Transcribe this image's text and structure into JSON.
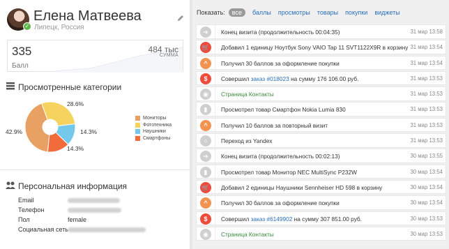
{
  "profile": {
    "name": "Елена Матвеева",
    "city": "Липецк, Россия"
  },
  "stats": {
    "main_value": "335",
    "main_label": "Балл",
    "sum_value": "484 тыс",
    "sum_label": "СУММА"
  },
  "categories": {
    "title": "Просмотренные категории",
    "legend": [
      "Мониторы",
      "Фототехника",
      "Наушники",
      "Смартфоны"
    ]
  },
  "chart_data": {
    "type": "pie",
    "labels": [
      "Мониторы",
      "Фототехника",
      "Наушники",
      "Смартфоны"
    ],
    "values": [
      42.9,
      28.6,
      14.3,
      14.3
    ],
    "value_labels": [
      "42.9%",
      "28.6%",
      "14.3%",
      "14.3%"
    ],
    "colors": [
      "#e8a163",
      "#f5d35e",
      "#73c8ec",
      "#f26b3b"
    ],
    "legend_position": "right"
  },
  "personal": {
    "title": "Персональная информация",
    "rows": [
      {
        "label": "Email",
        "value": ""
      },
      {
        "label": "Телефон",
        "value": ""
      },
      {
        "label": "Пол",
        "value": "female"
      },
      {
        "label": "Социальная сеть",
        "value": ""
      }
    ]
  },
  "filter": {
    "label": "Показать:",
    "tabs": [
      "все",
      "баллы",
      "просмотры",
      "товары",
      "покупки",
      "виджеты"
    ]
  },
  "feed": [
    {
      "icon": "exit-icon",
      "color": "#cfcfcf",
      "glyph": "➔",
      "text": "Конец визита (продолжительность 00:04:35)",
      "date": "31 мар 13:58"
    },
    {
      "icon": "cart-icon",
      "color": "#ef4b3c",
      "glyph": "🛒",
      "text": "Добавил 1 единицу Ноутбук Sony VAIO Tap 11 SVT1122X9R в корзину",
      "date": "31 мар 13:54"
    },
    {
      "icon": "points-up-icon",
      "color": "#f4934f",
      "glyph": "^",
      "text": "Получил 30 баллов за оформление покупки",
      "date": "31 мар 13:54"
    },
    {
      "icon": "dollar-icon",
      "color": "#ef4b3c",
      "glyph": "$",
      "pre": "Совершил ",
      "link": "заказ #018023",
      "post": " на сумму 176 106.00 руб.",
      "date": "31 мар 13:53"
    },
    {
      "icon": "eye-icon",
      "color": "#cfcfcf",
      "glyph": "◉",
      "text": "Страница Контакты",
      "green": true,
      "date": "31 мар 13:53"
    },
    {
      "icon": "monitor-icon",
      "color": "#cfcfcf",
      "glyph": "▮",
      "text": "Просмотрел товар Смартфон Nokia Lumia 830",
      "date": "31 мар 13:53"
    },
    {
      "icon": "points-up-icon",
      "color": "#f4934f",
      "glyph": "^",
      "text": "Получил 10 баллов за повторный визит",
      "date": "31 мар 13:53"
    },
    {
      "icon": "search-icon",
      "color": "#cfcfcf",
      "glyph": "○",
      "text": "Переход из Yandex",
      "date": "31 мар 13:53"
    },
    {
      "icon": "exit-icon",
      "color": "#cfcfcf",
      "glyph": "➔",
      "text": "Конец визита (продолжительность 00:02:13)",
      "date": "30 мар 13:55"
    },
    {
      "icon": "monitor-icon",
      "color": "#cfcfcf",
      "glyph": "▮",
      "text": "Просмотрел товар Монитор NEC MultiSync P232W",
      "date": "30 мар 13:54"
    },
    {
      "icon": "cart-icon",
      "color": "#ef4b3c",
      "glyph": "🛒",
      "text": "Добавил 2 единицы Наушники Sennheiser HD 598 в корзину",
      "date": "30 мар 13:54"
    },
    {
      "icon": "points-up-icon",
      "color": "#f4934f",
      "glyph": "^",
      "text": "Получил 30 баллов за оформление покупки",
      "date": "30 мар 13:54"
    },
    {
      "icon": "dollar-icon",
      "color": "#ef4b3c",
      "glyph": "$",
      "pre": "Совершил ",
      "link": "заказ #6149902",
      "post": " на сумму 307 851.00 руб.",
      "date": "30 мар 13:53"
    },
    {
      "icon": "eye-icon",
      "color": "#cfcfcf",
      "glyph": "◉",
      "text": "Страница Контакты",
      "green": true,
      "date": "30 мар 13:53"
    }
  ]
}
